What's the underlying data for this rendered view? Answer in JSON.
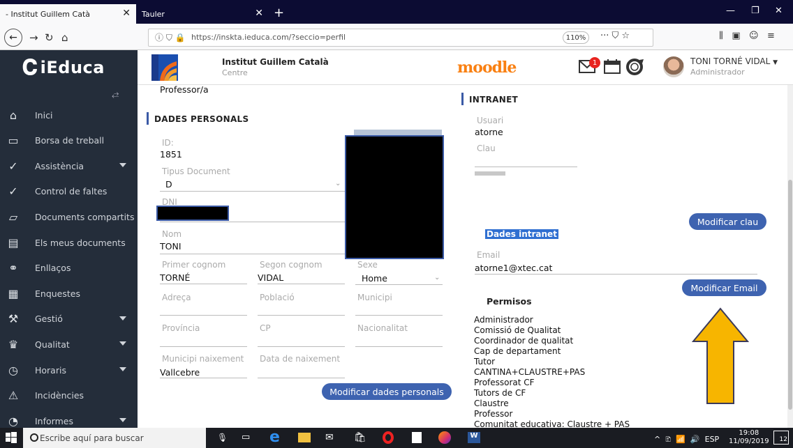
{
  "browser": {
    "tabs": [
      {
        "title": "- Institut Guillem Catà"
      },
      {
        "title": "Tauler"
      }
    ],
    "url": "https://inskta.ieduca.com/?seccio=perfil",
    "zoom": "110%"
  },
  "app": {
    "brand": "iEduca",
    "school": {
      "name": "Institut Guillem Català",
      "sub": "Centre"
    },
    "moodle": "moodle",
    "mail_badge": "1",
    "user": {
      "name": "TONI TORNÉ VIDAL",
      "role": "Administrador"
    }
  },
  "sidebar": {
    "items": [
      {
        "label": "Inici",
        "icon": "home-icon",
        "caret": false
      },
      {
        "label": "Borsa de treball",
        "icon": "briefcase-icon",
        "caret": false
      },
      {
        "label": "Assistència",
        "icon": "check-circle-icon",
        "caret": true
      },
      {
        "label": "Control de faltes",
        "icon": "check-circle-icon",
        "caret": false
      },
      {
        "label": "Documents compartits",
        "icon": "folder-icon",
        "caret": false
      },
      {
        "label": "Els meus documents",
        "icon": "document-icon",
        "caret": false
      },
      {
        "label": "Enllaços",
        "icon": "link-icon",
        "caret": false
      },
      {
        "label": "Enquestes",
        "icon": "clipboard-icon",
        "caret": false
      },
      {
        "label": "Gestió",
        "icon": "chart-icon",
        "caret": true
      },
      {
        "label": "Qualitat",
        "icon": "trophy-icon",
        "caret": true
      },
      {
        "label": "Horaris",
        "icon": "clock-icon",
        "caret": true
      },
      {
        "label": "Incidències",
        "icon": "warning-icon",
        "caret": false
      },
      {
        "label": "Informes",
        "icon": "pie-chart-icon",
        "caret": true
      }
    ]
  },
  "profile": {
    "role_line": "Professor/a",
    "section_title": "DADES PERSONALS",
    "fields": {
      "id": {
        "label": "ID:",
        "value": "1851"
      },
      "tipus_document": {
        "label": "Tipus Document",
        "value": "D"
      },
      "dni": {
        "label": "DNI"
      },
      "nom": {
        "label": "Nom",
        "value": "TONI"
      },
      "primer_cognom": {
        "label": "Primer cognom",
        "value": "TORNÉ"
      },
      "segon_cognom": {
        "label": "Segon cognom",
        "value": "VIDAL"
      },
      "sexe": {
        "label": "Sexe",
        "value": "Home"
      },
      "adreca": {
        "label": "Adreça"
      },
      "poblacio": {
        "label": "Població"
      },
      "municipi": {
        "label": "Municipi"
      },
      "provincia": {
        "label": "Província"
      },
      "cp": {
        "label": "CP"
      },
      "nacionalitat": {
        "label": "Nacionalitat"
      },
      "municipi_naixement": {
        "label": "Municipi naixement",
        "value": "Vallcebre"
      },
      "data_naixement": {
        "label": "Data de naixement"
      }
    },
    "save_button": "Modificar dades personals"
  },
  "intranet": {
    "section_title": "INTRANET",
    "usuari": {
      "label": "Usuari",
      "value": "atorne"
    },
    "clau": {
      "label": "Clau"
    },
    "modify_key_button": "Modificar clau",
    "dades_intranet": "Dades intranet",
    "email": {
      "label": "Email",
      "value": "atorne1@xtec.cat"
    },
    "modify_email_button": "Modificar Email",
    "permisos_title": "Permisos",
    "permisos": [
      "Administrador",
      "Comissió de Qualitat",
      "Coordinador de qualitat",
      "Cap de departament",
      "Tutor",
      "CANTINA+CLAUSTRE+PAS",
      "Professorat CF",
      "Tutors de CF",
      "Claustre",
      "Professor",
      "Comunitat educativa: Claustre + PAS"
    ]
  },
  "taskbar": {
    "search_placeholder": "Escribe aquí para buscar",
    "lang": "ESP",
    "time": "19:08",
    "date": "11/09/2019",
    "notif_count": "12"
  },
  "colors": {
    "sidebar": "#242d3a",
    "button": "#3e63b0",
    "arrow": "#f7b500",
    "highlight": "#2f6fd1"
  }
}
